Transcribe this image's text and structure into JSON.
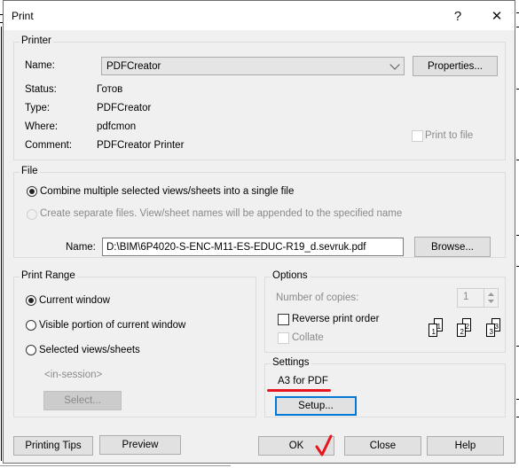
{
  "window": {
    "title": "Print",
    "help_label": "?",
    "close_label": "✕"
  },
  "printer": {
    "legend": "Printer",
    "name_label": "Name:",
    "name_value": "PDFCreator",
    "properties_label": "Properties...",
    "status_label": "Status:",
    "status_value": "Готов",
    "type_label": "Type:",
    "type_value": "PDFCreator",
    "where_label": "Where:",
    "where_value": "pdfcmon",
    "comment_label": "Comment:",
    "comment_value": "PDFCreator Printer",
    "print_to_file_label": "Print to file",
    "print_to_file_checked": false
  },
  "file": {
    "legend": "File",
    "combine_label": "Combine multiple selected views/sheets into a single file",
    "separate_label": "Create separate files. View/sheet names will be appended to the specified name",
    "selected": "combine",
    "name_label": "Name:",
    "name_value": "D:\\BIM\\6P4020-S-ENC-M11-ES-EDUC-R19_d.sevruk.pdf",
    "browse_label": "Browse..."
  },
  "print_range": {
    "legend": "Print Range",
    "options": [
      {
        "label": "Current window",
        "checked": true
      },
      {
        "label": "Visible portion of current window",
        "checked": false
      },
      {
        "label": "Selected views/sheets",
        "checked": false
      }
    ],
    "in_session": "<in-session>",
    "select_label": "Select..."
  },
  "options": {
    "legend": "Options",
    "copies_label": "Number of copies:",
    "copies_value": "1",
    "reverse_label": "Reverse print order",
    "reverse_checked": false,
    "collate_label": "Collate",
    "collate_checked": false,
    "collate_icon_pages": [
      "1",
      "2",
      "3"
    ]
  },
  "settings": {
    "legend": "Settings",
    "value": "A3 for PDF",
    "setup_label": "Setup..."
  },
  "footer": {
    "printing_tips_label": "Printing Tips",
    "preview_label": "Preview",
    "ok_label": "OK",
    "close_label": "Close",
    "help_label": "Help"
  },
  "annotations": {
    "underline_color": "#e8141e",
    "checkmark_color": "#e8141e",
    "focus_color": "#0078d7"
  }
}
